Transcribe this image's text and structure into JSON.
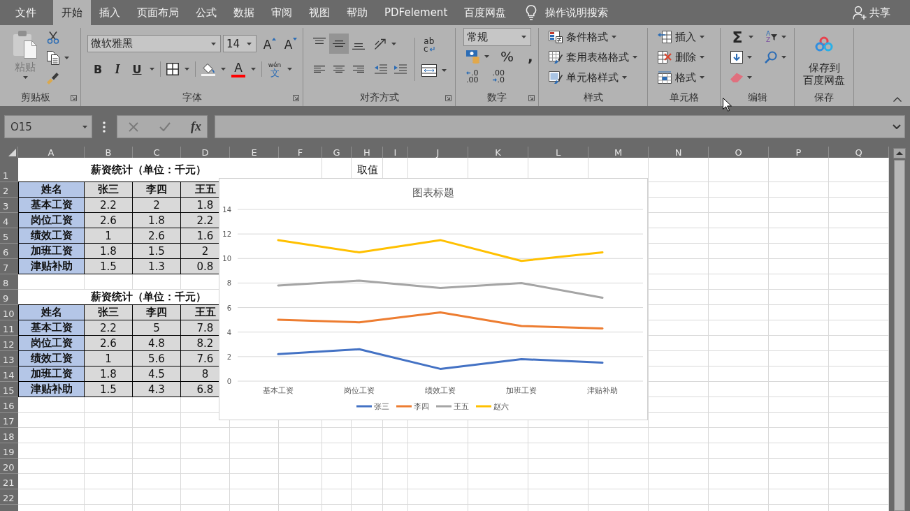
{
  "tabs": [
    {
      "label": "文件",
      "selected": false
    },
    {
      "label": "开始",
      "selected": true
    },
    {
      "label": "插入",
      "selected": false
    },
    {
      "label": "页面布局",
      "selected": false
    },
    {
      "label": "公式",
      "selected": false
    },
    {
      "label": "数据",
      "selected": false
    },
    {
      "label": "审阅",
      "selected": false
    },
    {
      "label": "视图",
      "selected": false
    },
    {
      "label": "帮助",
      "selected": false
    },
    {
      "label": "PDFelement",
      "selected": false
    },
    {
      "label": "百度网盘",
      "selected": false
    }
  ],
  "tell_me": {
    "label": "操作说明搜索"
  },
  "share": {
    "label": "共享"
  },
  "ribbon": {
    "groups": [
      {
        "kind": "clipboard",
        "label": "剪贴板",
        "launcher": true,
        "paste": {
          "label": "粘贴",
          "disabled": true
        }
      },
      {
        "kind": "font",
        "label": "字体",
        "launcher": true,
        "font_name": "微软雅黑",
        "font_size": "14",
        "grow": "A",
        "shrink": "A",
        "bold": "B",
        "italic": "I",
        "underline": "U",
        "font_color": "A",
        "phonetic": [
          "wén",
          "文"
        ]
      },
      {
        "kind": "alignment",
        "label": "对齐方式",
        "launcher": true,
        "vertical": [
          {
            "kind": "top",
            "selected": false
          },
          {
            "kind": "middle",
            "selected": true
          },
          {
            "kind": "bottom",
            "selected": false
          }
        ],
        "horizontal": [
          {
            "kind": "left",
            "selected": false
          },
          {
            "kind": "center",
            "selected": false
          },
          {
            "kind": "right",
            "selected": false
          }
        ],
        "wrap": [
          "ab",
          "c"
        ]
      },
      {
        "kind": "number",
        "label": "数字",
        "launcher": true,
        "format": "常规",
        "percent": "%",
        "comma": ",",
        "increase_decimal": [
          ".0",
          ".00"
        ],
        "decrease_decimal": [
          ".00",
          ".0"
        ]
      },
      {
        "kind": "styles",
        "label": "样式",
        "launcher": false,
        "items": [
          {
            "kind": "conditional",
            "label": "条件格式"
          },
          {
            "kind": "table",
            "label": "套用表格格式"
          },
          {
            "kind": "cell_style",
            "label": "单元格样式"
          }
        ]
      },
      {
        "kind": "cells",
        "label": "单元格",
        "launcher": false,
        "items": [
          {
            "kind": "insert",
            "label": "插入"
          },
          {
            "kind": "delete",
            "label": "删除"
          },
          {
            "kind": "format",
            "label": "格式"
          }
        ]
      },
      {
        "kind": "editing",
        "label": "编辑",
        "launcher": false,
        "sum": "Σ",
        "sort": [
          "A",
          "Z"
        ]
      },
      {
        "kind": "save",
        "label": "保存",
        "launcher": false,
        "button": [
          "保存到",
          "百度网盘"
        ]
      }
    ]
  },
  "formula_bar": {
    "name_box": "O15",
    "fx": "fx"
  },
  "sheet": {
    "columns": [
      "A",
      "B",
      "C",
      "D",
      "E",
      "F",
      "G",
      "H",
      "I",
      "J",
      "K",
      "L",
      "M",
      "N",
      "O",
      "P",
      "Q"
    ],
    "row_numbers": [
      "1",
      "2",
      "3",
      "4",
      "5",
      "6",
      "7",
      "8",
      "9",
      "10",
      "11",
      "12",
      "13",
      "14",
      "15",
      "16",
      "17",
      "18",
      "19",
      "20",
      "21",
      "22"
    ],
    "note_cell": "取值",
    "tables": [
      {
        "title": "薪资统计（单位：千元）",
        "columns": [
          "姓名",
          "张三",
          "李四",
          "王五"
        ],
        "rows": [
          [
            "基本工资",
            "2.2",
            "2",
            "1.8"
          ],
          [
            "岗位工资",
            "2.6",
            "1.8",
            "2.2"
          ],
          [
            "绩效工资",
            "1",
            "2.6",
            "1.6"
          ],
          [
            "加班工资",
            "1.8",
            "1.5",
            "2"
          ],
          [
            "津贴补助",
            "1.5",
            "1.3",
            "0.8"
          ]
        ]
      },
      {
        "title": "薪资统计（单位：千元）",
        "columns": [
          "姓名",
          "张三",
          "李四",
          "王五"
        ],
        "rows": [
          [
            "基本工资",
            "2.2",
            "5",
            "7.8"
          ],
          [
            "岗位工资",
            "2.6",
            "4.8",
            "8.2"
          ],
          [
            "绩效工资",
            "1",
            "5.6",
            "7.6"
          ],
          [
            "加班工资",
            "1.8",
            "4.5",
            "8"
          ],
          [
            "津贴补助",
            "1.5",
            "4.3",
            "6.8"
          ]
        ]
      }
    ],
    "chart": {
      "chart_data": {
        "type": "line",
        "title": "图表标题",
        "categories": [
          "基本工资",
          "岗位工资",
          "绩效工资",
          "加班工资",
          "津贴补助"
        ],
        "series": [
          {
            "name": "张三",
            "color": "#4472c4",
            "values": [
              2.2,
              2.6,
              1,
              1.8,
              1.5
            ]
          },
          {
            "name": "李四",
            "color": "#ed7d31",
            "values": [
              5,
              4.8,
              5.6,
              4.5,
              4.3
            ]
          },
          {
            "name": "王五",
            "color": "#a5a5a5",
            "values": [
              7.8,
              8.2,
              7.6,
              8,
              6.8
            ]
          },
          {
            "name": "赵六",
            "color": "#ffc000",
            "values": [
              11.5,
              10.5,
              11.5,
              9.8,
              10.5
            ]
          }
        ],
        "ylim": [
          0,
          14
        ],
        "yticks": [
          {
            "value": 0,
            "label": "0"
          },
          {
            "value": 2,
            "label": "2"
          },
          {
            "value": 4,
            "label": "4"
          },
          {
            "value": 6,
            "label": "6"
          },
          {
            "value": 8,
            "label": "8"
          },
          {
            "value": 10,
            "label": "10"
          },
          {
            "value": 12,
            "label": "12"
          },
          {
            "value": 14,
            "label": "14"
          }
        ],
        "grid": true,
        "legend": "bottom"
      }
    }
  }
}
